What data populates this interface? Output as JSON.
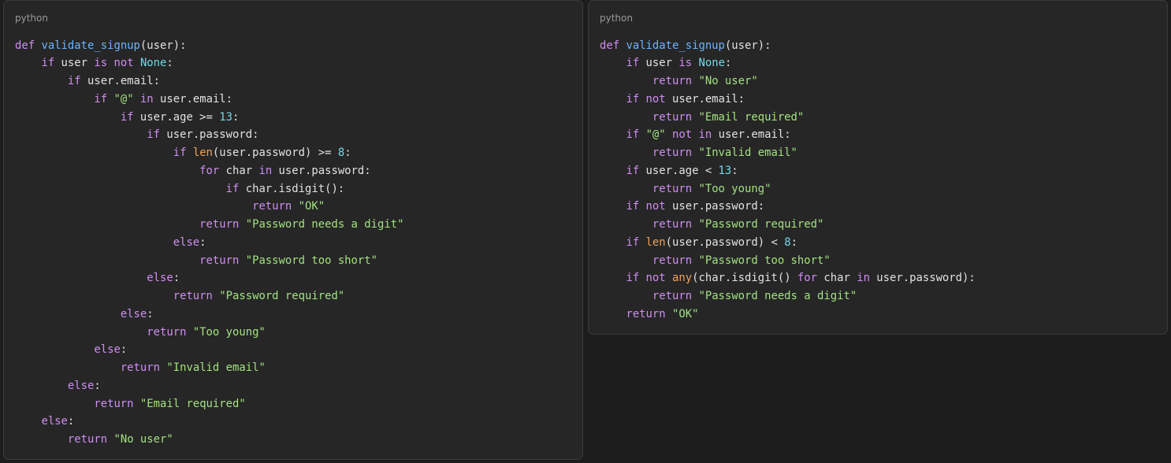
{
  "colors": {
    "background": "#1d1d1d",
    "panel": "#262626",
    "border": "#3b3b3b",
    "keyword": "#cf8ef2",
    "function": "#6cb3ff",
    "builtin": "#f0a35c",
    "string": "#a2e180",
    "number": "#74d9e8",
    "plain": "#e2e2e2"
  },
  "panels": [
    {
      "language": "python",
      "lines": [
        [
          [
            "kw",
            "def"
          ],
          [
            "pl",
            " "
          ],
          [
            "fn",
            "validate_signup"
          ],
          [
            "pl",
            "(user):"
          ]
        ],
        [
          [
            "pl",
            "    "
          ],
          [
            "kw",
            "if"
          ],
          [
            "pl",
            " user "
          ],
          [
            "kw",
            "is not"
          ],
          [
            "pl",
            " "
          ],
          [
            "con",
            "None"
          ],
          [
            "pl",
            ":"
          ]
        ],
        [
          [
            "pl",
            "        "
          ],
          [
            "kw",
            "if"
          ],
          [
            "pl",
            " user.email:"
          ]
        ],
        [
          [
            "pl",
            "            "
          ],
          [
            "kw",
            "if"
          ],
          [
            "pl",
            " "
          ],
          [
            "str",
            "\"@\""
          ],
          [
            "pl",
            " "
          ],
          [
            "kw",
            "in"
          ],
          [
            "pl",
            " user.email:"
          ]
        ],
        [
          [
            "pl",
            "                "
          ],
          [
            "kw",
            "if"
          ],
          [
            "pl",
            " user.age >= "
          ],
          [
            "num",
            "13"
          ],
          [
            "pl",
            ":"
          ]
        ],
        [
          [
            "pl",
            "                    "
          ],
          [
            "kw",
            "if"
          ],
          [
            "pl",
            " user.password:"
          ]
        ],
        [
          [
            "pl",
            "                        "
          ],
          [
            "kw",
            "if"
          ],
          [
            "pl",
            " "
          ],
          [
            "bi",
            "len"
          ],
          [
            "pl",
            "(user.password) >= "
          ],
          [
            "num",
            "8"
          ],
          [
            "pl",
            ":"
          ]
        ],
        [
          [
            "pl",
            "                            "
          ],
          [
            "kw",
            "for"
          ],
          [
            "pl",
            " char "
          ],
          [
            "kw",
            "in"
          ],
          [
            "pl",
            " user.password:"
          ]
        ],
        [
          [
            "pl",
            "                                "
          ],
          [
            "kw",
            "if"
          ],
          [
            "pl",
            " char.isdigit():"
          ]
        ],
        [
          [
            "pl",
            "                                    "
          ],
          [
            "kw",
            "return"
          ],
          [
            "pl",
            " "
          ],
          [
            "str",
            "\"OK\""
          ]
        ],
        [
          [
            "pl",
            "                            "
          ],
          [
            "kw",
            "return"
          ],
          [
            "pl",
            " "
          ],
          [
            "str",
            "\"Password needs a digit\""
          ]
        ],
        [
          [
            "pl",
            "                        "
          ],
          [
            "kw",
            "else"
          ],
          [
            "pl",
            ":"
          ]
        ],
        [
          [
            "pl",
            "                            "
          ],
          [
            "kw",
            "return"
          ],
          [
            "pl",
            " "
          ],
          [
            "str",
            "\"Password too short\""
          ]
        ],
        [
          [
            "pl",
            "                    "
          ],
          [
            "kw",
            "else"
          ],
          [
            "pl",
            ":"
          ]
        ],
        [
          [
            "pl",
            "                        "
          ],
          [
            "kw",
            "return"
          ],
          [
            "pl",
            " "
          ],
          [
            "str",
            "\"Password required\""
          ]
        ],
        [
          [
            "pl",
            "                "
          ],
          [
            "kw",
            "else"
          ],
          [
            "pl",
            ":"
          ]
        ],
        [
          [
            "pl",
            "                    "
          ],
          [
            "kw",
            "return"
          ],
          [
            "pl",
            " "
          ],
          [
            "str",
            "\"Too young\""
          ]
        ],
        [
          [
            "pl",
            "            "
          ],
          [
            "kw",
            "else"
          ],
          [
            "pl",
            ":"
          ]
        ],
        [
          [
            "pl",
            "                "
          ],
          [
            "kw",
            "return"
          ],
          [
            "pl",
            " "
          ],
          [
            "str",
            "\"Invalid email\""
          ]
        ],
        [
          [
            "pl",
            "        "
          ],
          [
            "kw",
            "else"
          ],
          [
            "pl",
            ":"
          ]
        ],
        [
          [
            "pl",
            "            "
          ],
          [
            "kw",
            "return"
          ],
          [
            "pl",
            " "
          ],
          [
            "str",
            "\"Email required\""
          ]
        ],
        [
          [
            "pl",
            "    "
          ],
          [
            "kw",
            "else"
          ],
          [
            "pl",
            ":"
          ]
        ],
        [
          [
            "pl",
            "        "
          ],
          [
            "kw",
            "return"
          ],
          [
            "pl",
            " "
          ],
          [
            "str",
            "\"No user\""
          ]
        ]
      ]
    },
    {
      "language": "python",
      "lines": [
        [
          [
            "kw",
            "def"
          ],
          [
            "pl",
            " "
          ],
          [
            "fn",
            "validate_signup"
          ],
          [
            "pl",
            "(user):"
          ]
        ],
        [
          [
            "pl",
            "    "
          ],
          [
            "kw",
            "if"
          ],
          [
            "pl",
            " user "
          ],
          [
            "kw",
            "is"
          ],
          [
            "pl",
            " "
          ],
          [
            "con",
            "None"
          ],
          [
            "pl",
            ":"
          ]
        ],
        [
          [
            "pl",
            "        "
          ],
          [
            "kw",
            "return"
          ],
          [
            "pl",
            " "
          ],
          [
            "str",
            "\"No user\""
          ]
        ],
        [
          [
            "pl",
            "    "
          ],
          [
            "kw",
            "if not"
          ],
          [
            "pl",
            " user.email:"
          ]
        ],
        [
          [
            "pl",
            "        "
          ],
          [
            "kw",
            "return"
          ],
          [
            "pl",
            " "
          ],
          [
            "str",
            "\"Email required\""
          ]
        ],
        [
          [
            "pl",
            "    "
          ],
          [
            "kw",
            "if"
          ],
          [
            "pl",
            " "
          ],
          [
            "str",
            "\"@\""
          ],
          [
            "pl",
            " "
          ],
          [
            "kw",
            "not in"
          ],
          [
            "pl",
            " user.email:"
          ]
        ],
        [
          [
            "pl",
            "        "
          ],
          [
            "kw",
            "return"
          ],
          [
            "pl",
            " "
          ],
          [
            "str",
            "\"Invalid email\""
          ]
        ],
        [
          [
            "pl",
            "    "
          ],
          [
            "kw",
            "if"
          ],
          [
            "pl",
            " user.age < "
          ],
          [
            "num",
            "13"
          ],
          [
            "pl",
            ":"
          ]
        ],
        [
          [
            "pl",
            "        "
          ],
          [
            "kw",
            "return"
          ],
          [
            "pl",
            " "
          ],
          [
            "str",
            "\"Too young\""
          ]
        ],
        [
          [
            "pl",
            "    "
          ],
          [
            "kw",
            "if not"
          ],
          [
            "pl",
            " user.password:"
          ]
        ],
        [
          [
            "pl",
            "        "
          ],
          [
            "kw",
            "return"
          ],
          [
            "pl",
            " "
          ],
          [
            "str",
            "\"Password required\""
          ]
        ],
        [
          [
            "pl",
            "    "
          ],
          [
            "kw",
            "if"
          ],
          [
            "pl",
            " "
          ],
          [
            "bi",
            "len"
          ],
          [
            "pl",
            "(user.password) < "
          ],
          [
            "num",
            "8"
          ],
          [
            "pl",
            ":"
          ]
        ],
        [
          [
            "pl",
            "        "
          ],
          [
            "kw",
            "return"
          ],
          [
            "pl",
            " "
          ],
          [
            "str",
            "\"Password too short\""
          ]
        ],
        [
          [
            "pl",
            "    "
          ],
          [
            "kw",
            "if not"
          ],
          [
            "pl",
            " "
          ],
          [
            "bi",
            "any"
          ],
          [
            "pl",
            "(char.isdigit() "
          ],
          [
            "kw",
            "for"
          ],
          [
            "pl",
            " char "
          ],
          [
            "kw",
            "in"
          ],
          [
            "pl",
            " user.password):"
          ]
        ],
        [
          [
            "pl",
            "        "
          ],
          [
            "kw",
            "return"
          ],
          [
            "pl",
            " "
          ],
          [
            "str",
            "\"Password needs a digit\""
          ]
        ],
        [
          [
            "pl",
            "    "
          ],
          [
            "kw",
            "return"
          ],
          [
            "pl",
            " "
          ],
          [
            "str",
            "\"OK\""
          ]
        ]
      ]
    }
  ]
}
